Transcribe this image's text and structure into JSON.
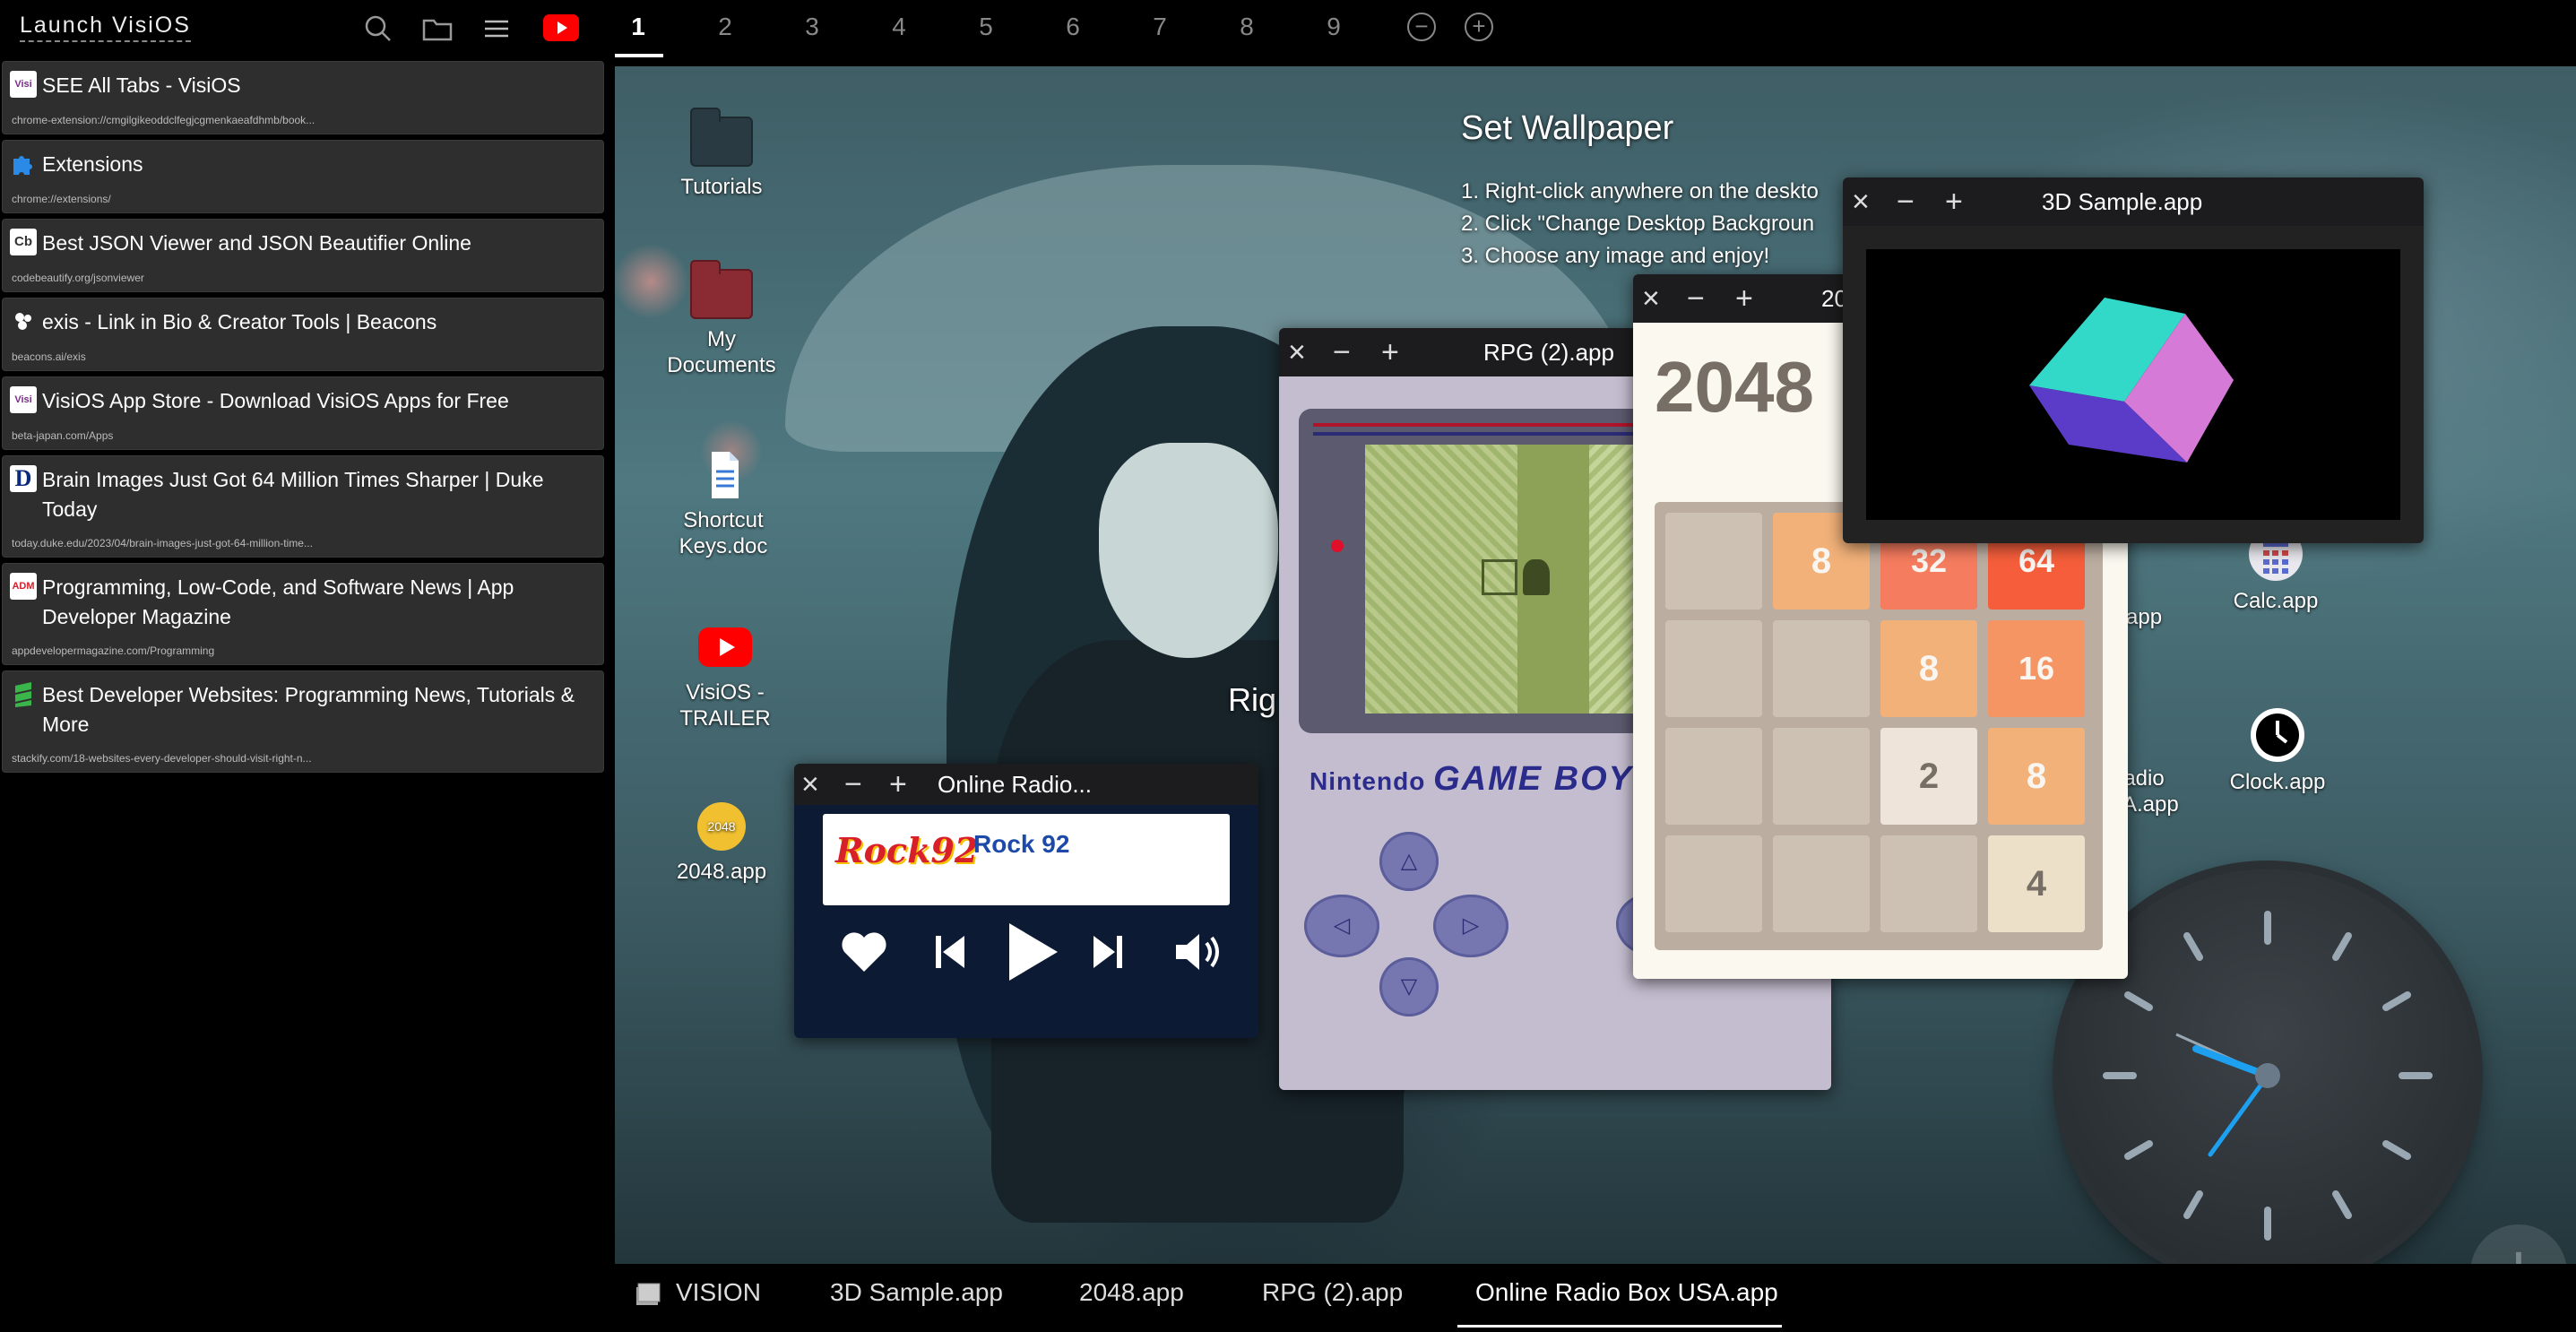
{
  "sidebar": {
    "title": "Launch VisiOS",
    "tabs": [
      {
        "title": "SEE All Tabs - VisiOS",
        "url": "chrome-extension://cmgilgikeoddclfegjcgmenkaeafdhmb/book...",
        "favicon": "Visi"
      },
      {
        "title": "Extensions",
        "url": "chrome://extensions/",
        "favicon": ""
      },
      {
        "title": "Best JSON Viewer and JSON Beautifier Online",
        "url": "codebeautify.org/jsonviewer",
        "favicon": "Cb"
      },
      {
        "title": "exis - Link in Bio & Creator Tools | Beacons",
        "url": "beacons.ai/exis",
        "favicon": ""
      },
      {
        "title": "VisiOS App Store - Download VisiOS Apps for Free",
        "url": "beta-japan.com/Apps",
        "favicon": "Visi"
      },
      {
        "title": "Brain Images Just Got 64 Million Times Sharper | Duke Today",
        "url": "today.duke.edu/2023/04/brain-images-just-got-64-million-time...",
        "favicon": "D"
      },
      {
        "title": "Programming, Low-Code, and Software News | App Developer Magazine",
        "url": "appdevelopermagazine.com/Programming",
        "favicon": "ADM"
      },
      {
        "title": "Best Developer Websites: Programming News, Tutorials & More",
        "url": "stackify.com/18-websites-every-developer-should-visit-right-n...",
        "favicon": ""
      }
    ]
  },
  "workspaces": [
    "1",
    "2",
    "3",
    "4",
    "5",
    "6",
    "7",
    "8",
    "9"
  ],
  "workspace_zoom_out": "−",
  "workspace_zoom_in": "+",
  "desktop_icons": [
    {
      "label": "Tutorials"
    },
    {
      "label": "My Documents"
    },
    {
      "label": "Shortcut Keys.doc"
    },
    {
      "label": "VisiOS - TRAILER"
    },
    {
      "label": "2048.app"
    },
    {
      "label": "Calc.app"
    },
    {
      "label": "Clock.app"
    },
    {
      "label": "e.app"
    },
    {
      "label": "Radio SA.app"
    }
  ],
  "wallpaper_help": {
    "title": "Set Wallpaper",
    "step1": "1. Right-click anywhere on the deskto",
    "step2": "2. Click \"Change Desktop Backgroun",
    "step3": "3. Choose any image and enjoy!",
    "partial": "Rig"
  },
  "windows": {
    "rpg": {
      "title": "RPG (2).app",
      "brand1": "Nintendo",
      "brand2": "GAME BOY"
    },
    "g2048": {
      "title": "2048",
      "heading": "2048",
      "cells": [
        [
          "",
          "8",
          "32",
          "64"
        ],
        [
          "",
          "",
          "8",
          "16"
        ],
        [
          "",
          "",
          "2",
          "8"
        ],
        [
          "",
          "",
          "",
          "4"
        ]
      ]
    },
    "sample3d": {
      "title": "3D Sample.app"
    },
    "radio": {
      "title": "Online Radio...",
      "station": "Rock 92",
      "logo": "Rock92"
    }
  },
  "taskbar": {
    "items": [
      "VISION",
      "3D Sample.app",
      "2048.app",
      "RPG (2).app",
      "Online Radio Box USA.app"
    ],
    "active_index": 4
  },
  "colors": {
    "accent_youtube": "#ff0000",
    "radio_bg": "#0c1a33",
    "clock_hand": "#1ea0f0"
  }
}
